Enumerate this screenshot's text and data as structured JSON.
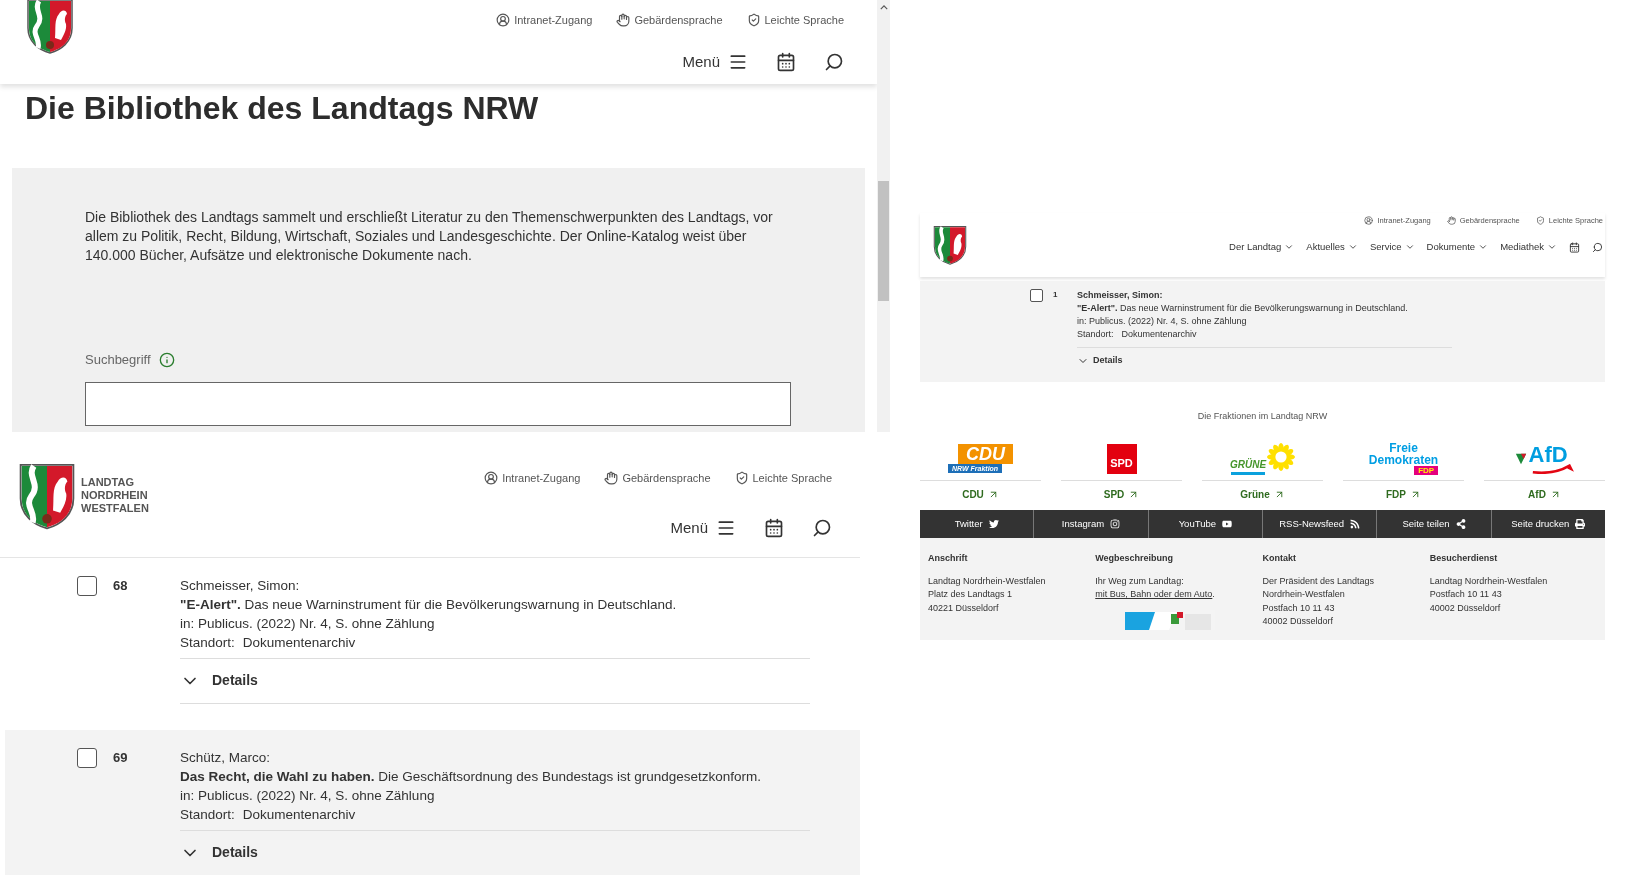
{
  "top_left": {
    "header": {
      "utility_links": [
        "Intranet-Zugang",
        "Gebärdensprache",
        "Leichte Sprache"
      ],
      "menu_label": "Menü"
    },
    "title": "Die Bibliothek des Landtags NRW",
    "intro": "Die Bibliothek des Landtags sammelt und erschließt Literatur zu den Themenschwerpunkten des Landtags, vor allem zu Politik, Recht, Bildung, Wirtschaft, Soziales und Landesgeschichte. Der Online-Katalog weist über 140.000 Bücher, Aufsätze und elektronische Dokumente nach.",
    "search": {
      "label": "Suchbegriff"
    }
  },
  "bottom_left": {
    "header": {
      "logo_text": [
        "LANDTAG",
        "NORDRHEIN",
        "WESTFALEN"
      ],
      "utility_links": [
        "Intranet-Zugang",
        "Gebärdensprache",
        "Leichte Sprache"
      ],
      "menu_label": "Menü"
    },
    "results": [
      {
        "number": "68",
        "checked": false,
        "author": "Schmeisser, Simon:",
        "title": "**\"E-Alert\".** Das neue Warninstrument für die Bevölkerungswarnung in Deutschland.",
        "source": "in: Publicus. (2022) Nr. 4, S. ohne Zählung",
        "location_label": "Standort:",
        "location": "Dokumentenarchiv",
        "details": "Details",
        "expanded": false
      },
      {
        "number": "69",
        "checked": false,
        "author": "Schütz, Marco:",
        "title": "**Das Recht, die Wahl zu haben.** Die Geschäftsordnung des Bundestags ist grundgesetzkonform.",
        "source": "in: Publicus. (2022) Nr. 4, S. ohne Zählung",
        "location_label": "Standort:",
        "location": "Dokumentenarchiv",
        "details": "Details",
        "expanded": false
      }
    ]
  },
  "right": {
    "header": {
      "utility_links": [
        "Intranet-Zugang",
        "Gebärdensprache",
        "Leichte Sprache"
      ],
      "nav": [
        "Der Landtag",
        "Aktuelles",
        "Service",
        "Dokumente",
        "Mediathek"
      ]
    },
    "results": [
      {
        "number": "1",
        "checked": false,
        "author": "Schmeisser, Simon:",
        "title": "**\"E-Alert\".** Das neue Warninstrument für die Bevölkerungswarnung in Deutschland.",
        "source": "in: Publicus. (2022) Nr. 4, S. ohne Zählung",
        "location_label": "Standort:",
        "location": "Dokumentenarchiv",
        "details": "Details",
        "expanded": false
      }
    ],
    "fraktionen": {
      "title": "Die Fraktionen im Landtag NRW",
      "parties": [
        {
          "kind": "cdu",
          "logo_text": [
            "CDU",
            "NRW Fraktion"
          ],
          "name": "CDU"
        },
        {
          "kind": "spd",
          "logo_text": [
            "SPD"
          ],
          "name": "SPD"
        },
        {
          "kind": "gruene",
          "logo_text": [
            "GRÜNE"
          ],
          "name": "Grüne"
        },
        {
          "kind": "fdp",
          "logo_text": [
            "Freie",
            "Demokraten",
            "FDP"
          ],
          "name": "FDP"
        },
        {
          "kind": "afd",
          "logo_text": [
            "AfD"
          ],
          "name": "AfD"
        }
      ]
    },
    "social": [
      "Twitter",
      "Instagram",
      "YouTube",
      "RSS-Newsfeed",
      "Seite teilen",
      "Seite drucken"
    ],
    "footer": [
      {
        "kind": "address",
        "heading": "Anschrift",
        "lines": [
          "Landtag Nordrhein-Westfalen",
          "Platz des Landtags 1",
          "40221 Düsseldorf"
        ]
      },
      {
        "kind": "directions",
        "heading": "Wegbeschreibung",
        "text": "Ihr Weg zum Landtag:",
        "link": "mit Bus, Bahn oder dem Auto",
        "after": "."
      },
      {
        "kind": "address",
        "heading": "Kontakt",
        "lines": [
          "Der Präsident des Landtags",
          "Nordrhein-Westfalen",
          "Postfach 10 11 43",
          "40002 Düsseldorf"
        ]
      },
      {
        "kind": "address",
        "heading": "Besucherdienst",
        "lines": [
          "Landtag Nordrhein-Westfalen",
          "Postfach 10 11 43",
          "40002 Düsseldorf"
        ]
      }
    ]
  }
}
